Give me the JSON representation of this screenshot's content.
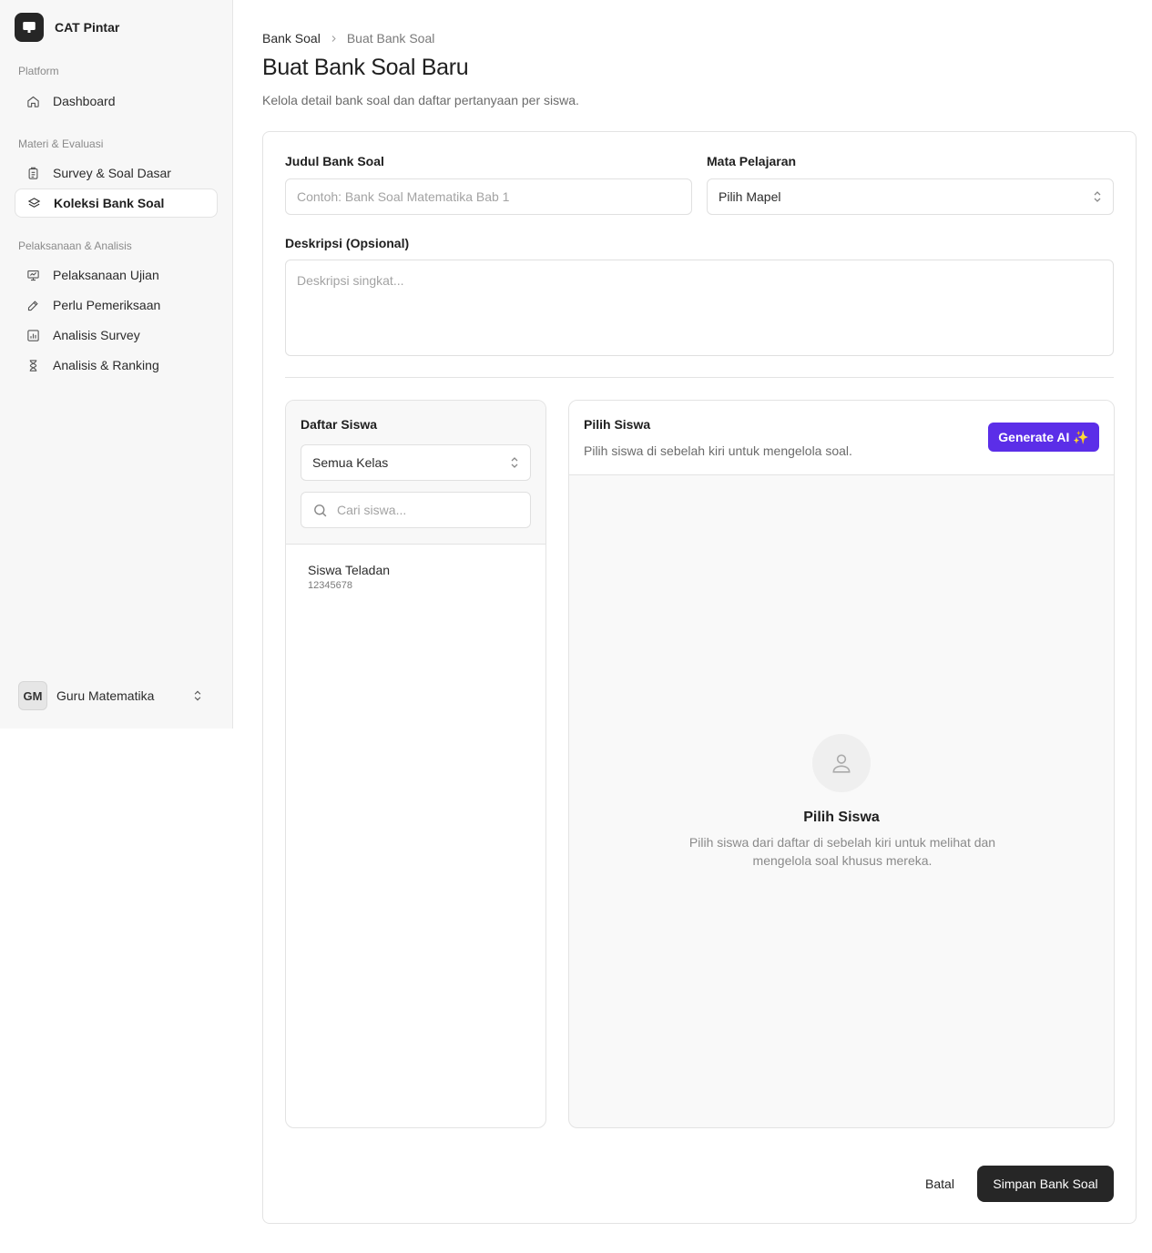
{
  "app": {
    "name": "CAT Pintar",
    "logo_icon": "monitor-icon"
  },
  "sidebar": {
    "groups": [
      {
        "label": "Platform",
        "items": [
          {
            "label": "Dashboard",
            "icon": "home-icon"
          }
        ]
      },
      {
        "label": "Materi & Evaluasi",
        "items": [
          {
            "label": "Survey & Soal Dasar",
            "icon": "clipboard-icon"
          },
          {
            "label": "Koleksi Bank Soal",
            "icon": "layers-icon",
            "active": true
          }
        ]
      },
      {
        "label": "Pelaksanaan & Analisis",
        "items": [
          {
            "label": "Pelaksanaan Ujian",
            "icon": "presentation-icon"
          },
          {
            "label": "Perlu Pemeriksaan",
            "icon": "edit-icon"
          },
          {
            "label": "Analisis Survey",
            "icon": "bar-chart-icon"
          },
          {
            "label": "Analisis & Ranking",
            "icon": "hourglass-icon"
          }
        ]
      }
    ],
    "user": {
      "initials": "GM",
      "name": "Guru Matematika"
    }
  },
  "breadcrumb": {
    "parent": "Bank Soal",
    "current": "Buat Bank Soal"
  },
  "page": {
    "title": "Buat Bank Soal Baru",
    "subtitle": "Kelola detail bank soal dan daftar pertanyaan per siswa."
  },
  "form": {
    "title_label": "Judul Bank Soal",
    "title_placeholder": "Contoh: Bank Soal Matematika Bab 1",
    "subject_label": "Mata Pelajaran",
    "subject_value": "Pilih Mapel",
    "desc_label": "Deskripsi (Opsional)",
    "desc_placeholder": "Deskripsi singkat..."
  },
  "students": {
    "title": "Daftar Siswa",
    "class_filter": "Semua Kelas",
    "search_placeholder": "Cari siswa...",
    "list": [
      {
        "name": "Siswa Teladan",
        "id": "12345678"
      }
    ]
  },
  "workspace": {
    "title": "Pilih Siswa",
    "subtitle": "Pilih siswa di sebelah kiri untuk mengelola soal.",
    "generate_label": "Generate AI ✨",
    "generate_color": "#5b2ee8",
    "empty_title": "Pilih Siswa",
    "empty_desc": "Pilih siswa dari daftar di sebelah kiri untuk melihat dan mengelola soal khusus mereka."
  },
  "actions": {
    "cancel": "Batal",
    "save": "Simpan Bank Soal"
  }
}
